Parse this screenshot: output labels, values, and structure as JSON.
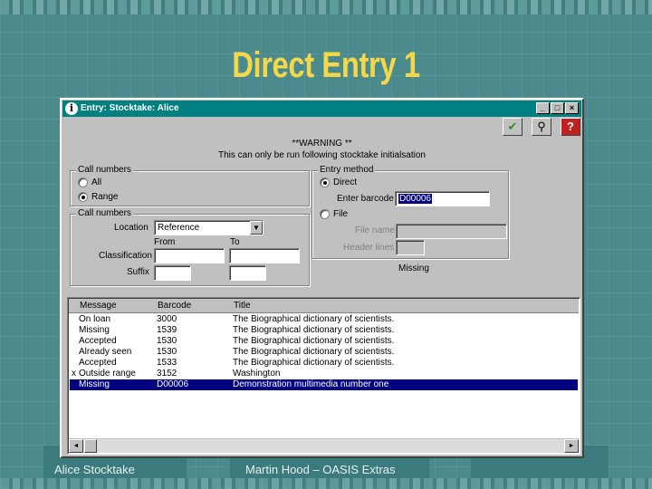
{
  "slide": {
    "title": "Direct Entry 1",
    "footer_left": "Alice Stocktake",
    "footer_center": "Martin Hood – OASIS Extras"
  },
  "window": {
    "icon_glyph": "i",
    "title": "Entry: Stocktake: Alice",
    "minimize_glyph": "_",
    "maximize_glyph": "□",
    "close_glyph": "×",
    "toolbar": {
      "ok_glyph": "✔",
      "find_glyph": "⚲",
      "help_glyph": "?"
    },
    "warning_title": "**WARNING **",
    "warning_text": "This can only be run following stocktake initialsation"
  },
  "call_numbers_range": {
    "label": "Call numbers",
    "option_all": "All",
    "option_range": "Range"
  },
  "call_numbers_fields": {
    "label": "Call numbers",
    "location_label": "Location",
    "location_value": "Reference",
    "from_label": "From",
    "to_label": "To",
    "classification_label": "Classification",
    "suffix_label": "Suffix",
    "classification_from": "",
    "classification_to": "",
    "suffix_from": "",
    "suffix_to": ""
  },
  "entry_method": {
    "label": "Entry method",
    "option_direct": "Direct",
    "barcode_label": "Enter barcode",
    "barcode_value": "D00006",
    "option_file": "File",
    "file_name_label": "File name",
    "file_name_value": "",
    "header_lines_label": "Header lines",
    "header_lines_value": "",
    "status_text": "Missing"
  },
  "results": {
    "headers": {
      "message": "Message",
      "barcode": "Barcode",
      "title": "Title"
    },
    "rows": [
      {
        "mark": "",
        "message": "On loan",
        "barcode": "3000",
        "title": "The Biographical dictionary of scientists."
      },
      {
        "mark": "",
        "message": "Missing",
        "barcode": "1539",
        "title": "The Biographical dictionary of scientists."
      },
      {
        "mark": "",
        "message": "Accepted",
        "barcode": "1530",
        "title": "The Biographical dictionary of scientists."
      },
      {
        "mark": "",
        "message": "Already seen",
        "barcode": "1530",
        "title": "The Biographical dictionary of scientists."
      },
      {
        "mark": "",
        "message": "Accepted",
        "barcode": "1533",
        "title": "The Biographical dictionary of scientists."
      },
      {
        "mark": "x",
        "message": "Outside range",
        "barcode": "3152",
        "title": "Washington"
      },
      {
        "mark": "",
        "message": "Missing",
        "barcode": "D00006",
        "title": "Demonstration multimedia number one"
      }
    ],
    "scroll_left_glyph": "◄",
    "scroll_right_glyph": "►"
  }
}
